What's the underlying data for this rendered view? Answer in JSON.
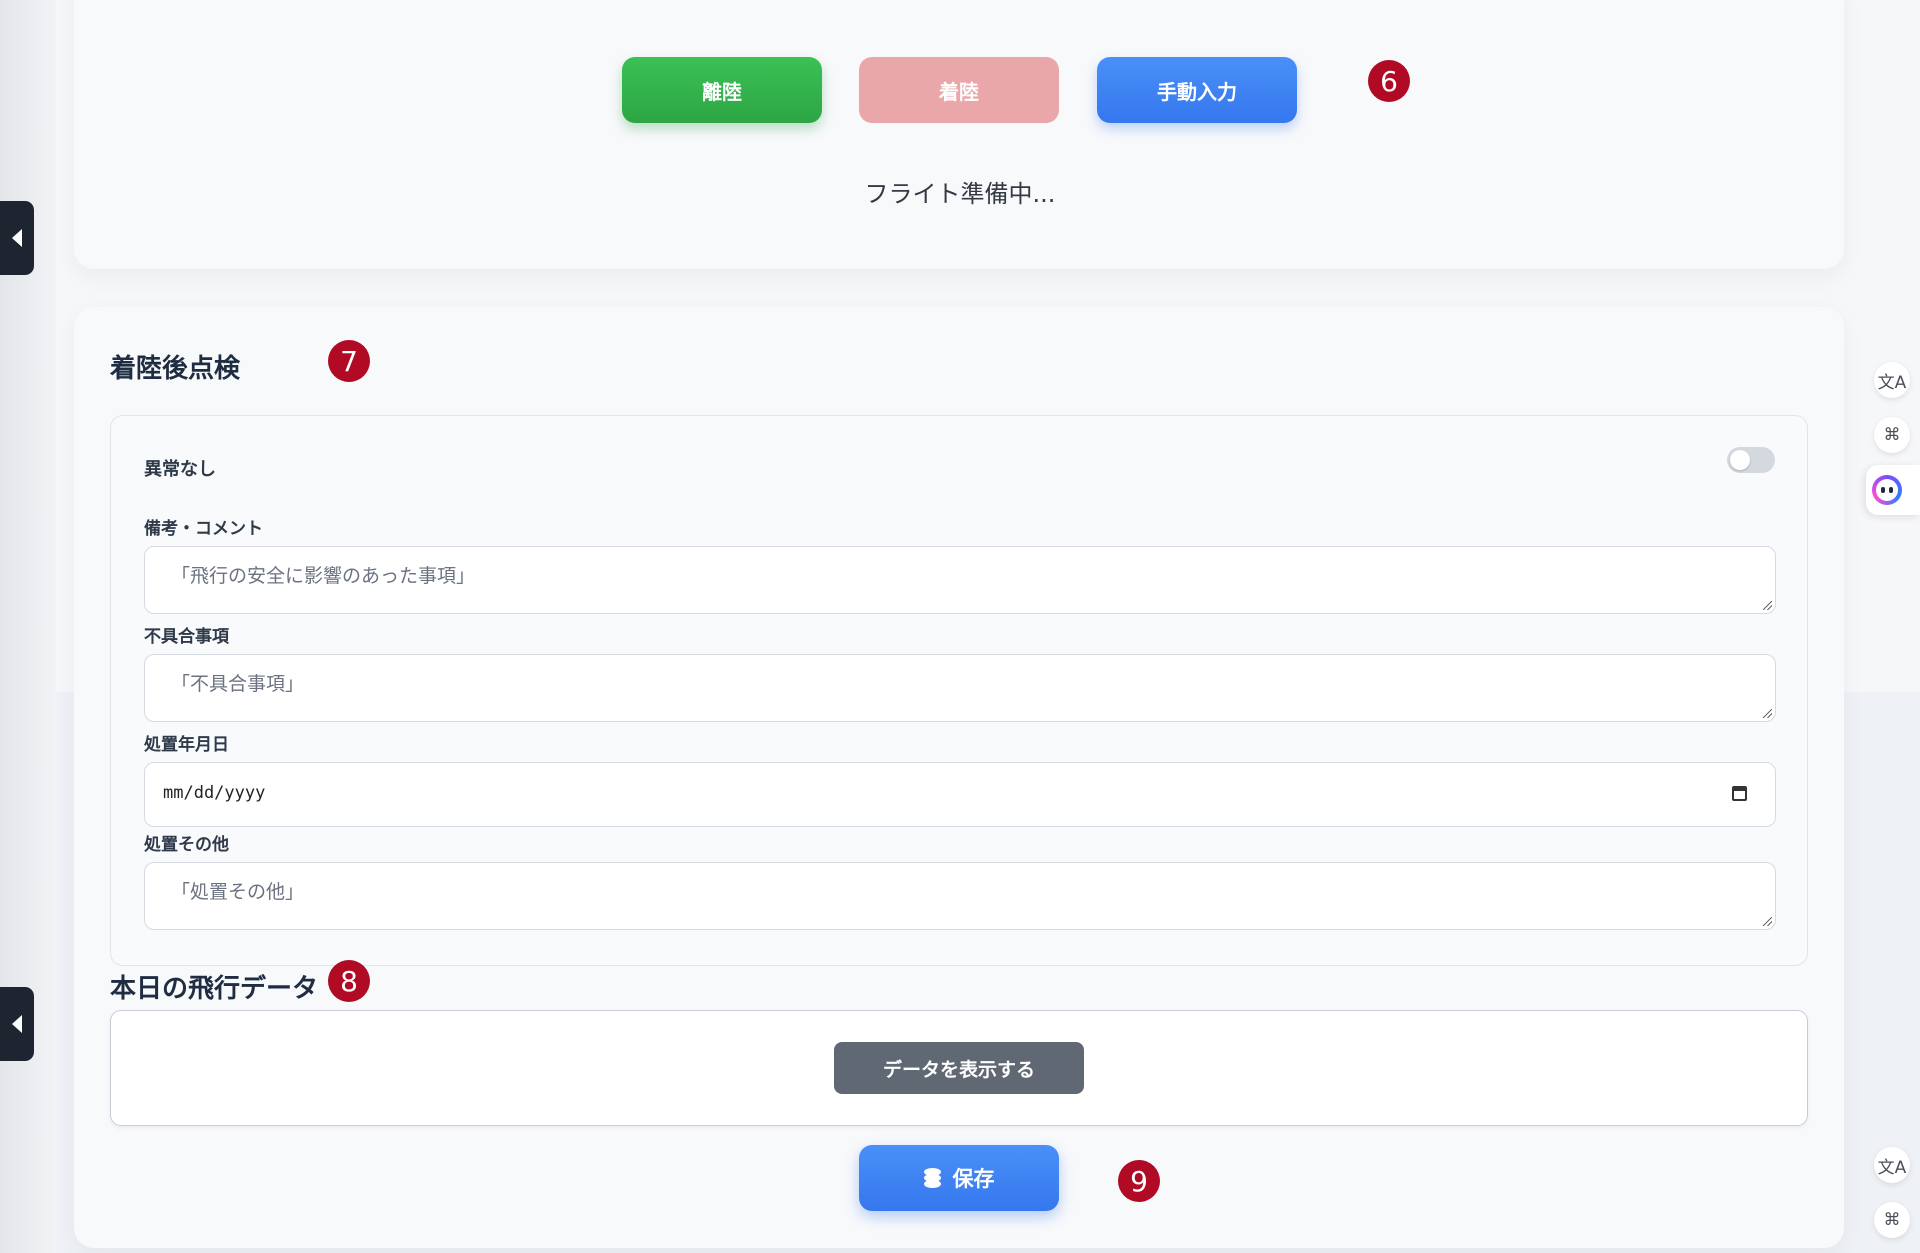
{
  "header_buttons": {
    "takeoff": "離陸",
    "landing": "着陸",
    "manual": "手動入力"
  },
  "markers": [
    "6",
    "7",
    "8",
    "9"
  ],
  "status_text": "フライト準備中...",
  "post_landing": {
    "title": "着陸後点検",
    "no_issue_label": "異常なし",
    "no_issue_toggle_on": false,
    "remarks_label": "備考・コメント",
    "remarks_placeholder": "「飛行の安全に影響のあった事項」",
    "defects_label": "不具合事項",
    "defects_placeholder": "「不具合事項」",
    "action_date_label": "処置年月日",
    "action_date_placeholder": "mm/dd/yyyy",
    "action_other_label": "処置その他",
    "action_other_placeholder": "「処置その他」"
  },
  "today_flight": {
    "title": "本日の飛行データ",
    "show_button": "データを表示する"
  },
  "save_button": "保存",
  "right_rail": {
    "icons": [
      "translate-icon",
      "apps-icon",
      "assistant-icon",
      "translate-icon",
      "apps-icon"
    ],
    "translate_glyph": "文A",
    "apps_glyph": "⌘"
  }
}
